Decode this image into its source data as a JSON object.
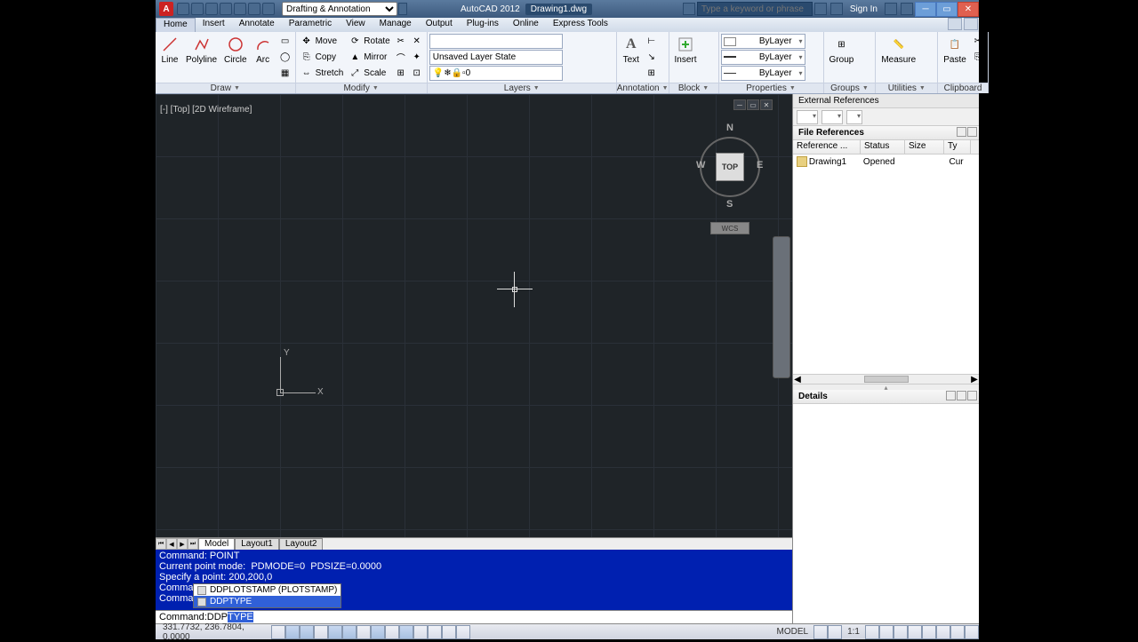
{
  "titlebar": {
    "workspace": "Drafting & Annotation",
    "app_name": "AutoCAD 2012",
    "doc_name": "Drawing1.dwg",
    "search_placeholder": "Type a keyword or phrase",
    "signin": "Sign In"
  },
  "menubar": {
    "items": [
      "Home",
      "Insert",
      "Annotate",
      "Parametric",
      "View",
      "Manage",
      "Output",
      "Plug-ins",
      "Online",
      "Express Tools"
    ]
  },
  "ribbon": {
    "draw": {
      "label": "Draw",
      "line": "Line",
      "polyline": "Polyline",
      "circle": "Circle",
      "arc": "Arc"
    },
    "modify": {
      "label": "Modify",
      "move": "Move",
      "copy": "Copy",
      "stretch": "Stretch",
      "rotate": "Rotate",
      "mirror": "Mirror",
      "scale": "Scale"
    },
    "layers": {
      "label": "Layers",
      "state": "Unsaved Layer State",
      "current": "0"
    },
    "annotation": {
      "label": "Annotation",
      "text": "Text"
    },
    "block": {
      "label": "Block",
      "insert": "Insert"
    },
    "properties": {
      "label": "Properties",
      "color": "ByLayer",
      "lw": "ByLayer",
      "lt": "ByLayer"
    },
    "groups": {
      "label": "Groups",
      "group": "Group"
    },
    "utilities": {
      "label": "Utilities",
      "measure": "Measure"
    },
    "clipboard": {
      "label": "Clipboard",
      "paste": "Paste"
    }
  },
  "viewport": {
    "label": "[-] [Top] [2D Wireframe]",
    "viewcube": {
      "face": "TOP",
      "wcs": "WCS",
      "n": "N",
      "s": "S",
      "e": "E",
      "w": "W"
    },
    "ucs": {
      "x": "X",
      "y": "Y"
    }
  },
  "xref": {
    "title": "External References",
    "header": "File References",
    "cols": {
      "name": "Reference ...",
      "status": "Status",
      "size": "Size",
      "type": "Ty"
    },
    "rows": [
      {
        "name": "Drawing1",
        "status": "Opened",
        "size": "",
        "type": "Cur"
      }
    ],
    "details": "Details"
  },
  "ltabs": {
    "model": "Model",
    "l1": "Layout1",
    "l2": "Layout2"
  },
  "cmd": {
    "lines": [
      "Command: POINT",
      "Current point mode:  PDMODE=0  PDSIZE=0.0000",
      "Specify a point: 200,200,0",
      "Comman",
      "Comman"
    ],
    "autocomplete": [
      {
        "text": "DDPLOTSTAMP (PLOTSTAMP)",
        "sel": false
      },
      {
        "text": "DDPTYPE",
        "sel": true
      }
    ],
    "prompt": "Command: ",
    "typed_prefix": "DDP",
    "typed_sel": "TYPE"
  },
  "statusbar": {
    "coords": "331.7732, 236.7804, 0.0000",
    "model": "MODEL",
    "scale": "1:1"
  }
}
